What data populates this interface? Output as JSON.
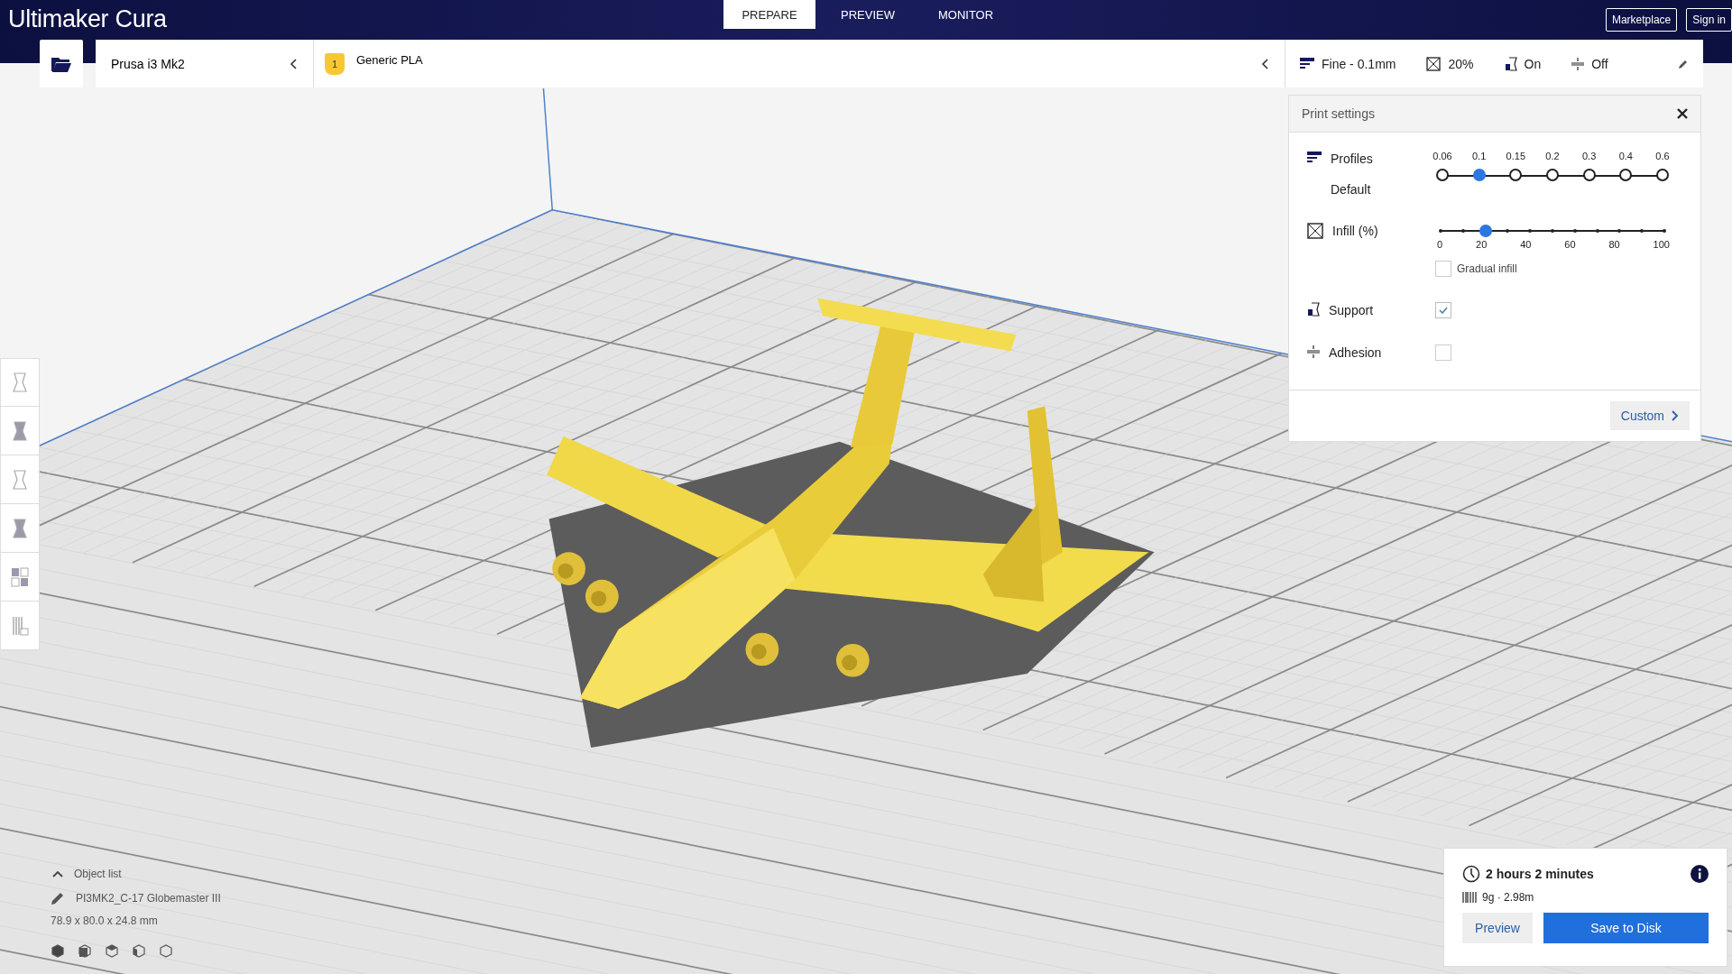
{
  "app": {
    "logo": "Ultimaker Cura"
  },
  "stages": [
    {
      "label": "PREPARE",
      "selected": true
    },
    {
      "label": "PREVIEW",
      "selected": false
    },
    {
      "label": "MONITOR",
      "selected": false
    }
  ],
  "account_buttons": [
    "Marketplace",
    "Sign in"
  ],
  "printer": {
    "name": "Prusa i3 Mk2"
  },
  "material": {
    "extruder": "1",
    "name": "Generic PLA"
  },
  "settings_summary": {
    "profile": "Fine - 0.1mm",
    "infill": "20%",
    "support": "On",
    "adhesion": "Off"
  },
  "print_settings": {
    "title": "Print settings",
    "profiles": {
      "label": "Profiles",
      "profile": "Default",
      "options": [
        {
          "label": "0.06",
          "selected": false
        },
        {
          "label": "0.1",
          "selected": true
        },
        {
          "label": "0.15",
          "selected": false
        },
        {
          "label": "0.2",
          "selected": false
        },
        {
          "label": "0.3",
          "selected": false
        },
        {
          "label": "0.4",
          "selected": false
        },
        {
          "label": "0.6",
          "selected": false
        }
      ]
    },
    "infill": {
      "label": "Infill (%)",
      "level": 0.2,
      "ticks": [
        "0",
        "20",
        "40",
        "60",
        "80",
        "100"
      ],
      "gradual": {
        "label": "Gradual infill",
        "checked": false
      }
    },
    "support": {
      "label": "Support",
      "checked": true
    },
    "adhesion": {
      "label": "Adhesion",
      "checked": false
    },
    "custom_button": "Custom"
  },
  "object_list": {
    "label": "Object list",
    "expanded": true,
    "object_name": "PI3MK2_C-17 Globemaster III",
    "dimensions": "78.9 x 80.0 x 24.8 mm"
  },
  "print_summary": {
    "time": "2 hours 2 minutes",
    "material": "9g · 2.98m",
    "buttons": [
      "Preview",
      "Save to Disk"
    ]
  }
}
